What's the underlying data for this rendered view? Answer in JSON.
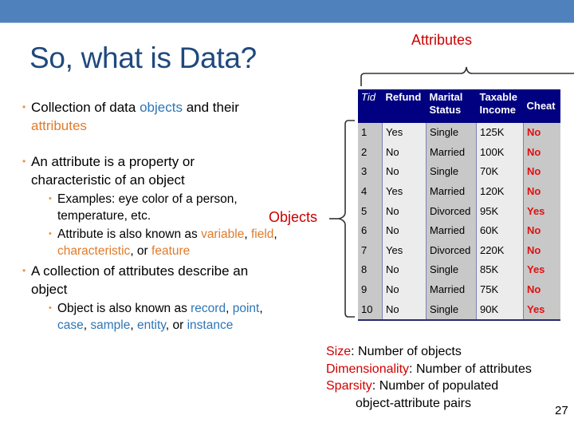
{
  "slide": {
    "title": "So, what is Data?",
    "page_number": "27",
    "colors": {
      "top_bar": "#4f81bd",
      "title": "#1f497d",
      "bullet_marker": "#e59440",
      "highlight_blue": "#2e75b6",
      "highlight_orange": "#e07b2c",
      "label_red": "#cc0000",
      "table_header": "#000080"
    }
  },
  "bullets": {
    "b1": {
      "t1": "Collection of data ",
      "objects": "objects",
      "t2": " and their ",
      "attributes": "attributes"
    },
    "b2": {
      "text": "An attribute is a property or characteristic of an object",
      "sub1": "Examples: eye color of a person, temperature, etc.",
      "sub2": {
        "t1": "Attribute is also known as ",
        "variable": "variable",
        "c1": ", ",
        "field": "field",
        "c2": ", ",
        "characteristic": "characteristic",
        "c3": ", or ",
        "feature": "feature"
      }
    },
    "b3": {
      "text": "A collection of attributes describe an object",
      "sub1": {
        "t1": "Object is also known as ",
        "record": "record",
        "c1": ", ",
        "point": "point",
        "c2": ", ",
        "case": "case",
        "c3": ", ",
        "sample": "sample",
        "c4": ", ",
        "entity": "entity",
        "c5": ", or ",
        "instance": "instance"
      }
    }
  },
  "labels": {
    "attributes": "Attributes",
    "objects": "Objects"
  },
  "table": {
    "headers": [
      "Tid",
      "Refund",
      "Marital Status",
      "Taxable Income",
      "Cheat"
    ],
    "header_lines": [
      [
        "Tid"
      ],
      [
        "Refund"
      ],
      [
        "Marital",
        "Status"
      ],
      [
        "Taxable",
        "Income"
      ],
      [
        "Cheat"
      ]
    ],
    "rows": [
      [
        "1",
        "Yes",
        "Single",
        "125K",
        "No"
      ],
      [
        "2",
        "No",
        "Married",
        "100K",
        "No"
      ],
      [
        "3",
        "No",
        "Single",
        "70K",
        "No"
      ],
      [
        "4",
        "Yes",
        "Married",
        "120K",
        "No"
      ],
      [
        "5",
        "No",
        "Divorced",
        "95K",
        "Yes"
      ],
      [
        "6",
        "No",
        "Married",
        "60K",
        "No"
      ],
      [
        "7",
        "Yes",
        "Divorced",
        "220K",
        "No"
      ],
      [
        "8",
        "No",
        "Single",
        "85K",
        "Yes"
      ],
      [
        "9",
        "No",
        "Married",
        "75K",
        "No"
      ],
      [
        "10",
        "No",
        "Single",
        "90K",
        "Yes"
      ]
    ]
  },
  "definitions": {
    "size_term": "Size",
    "size_desc": ": Number of objects",
    "dim_term": "Dimensionality",
    "dim_desc": ": Number of attributes",
    "sparsity_term": "Sparsity",
    "sparsity_desc": ": Number of populated",
    "sparsity_desc2": "object-attribute pairs"
  }
}
